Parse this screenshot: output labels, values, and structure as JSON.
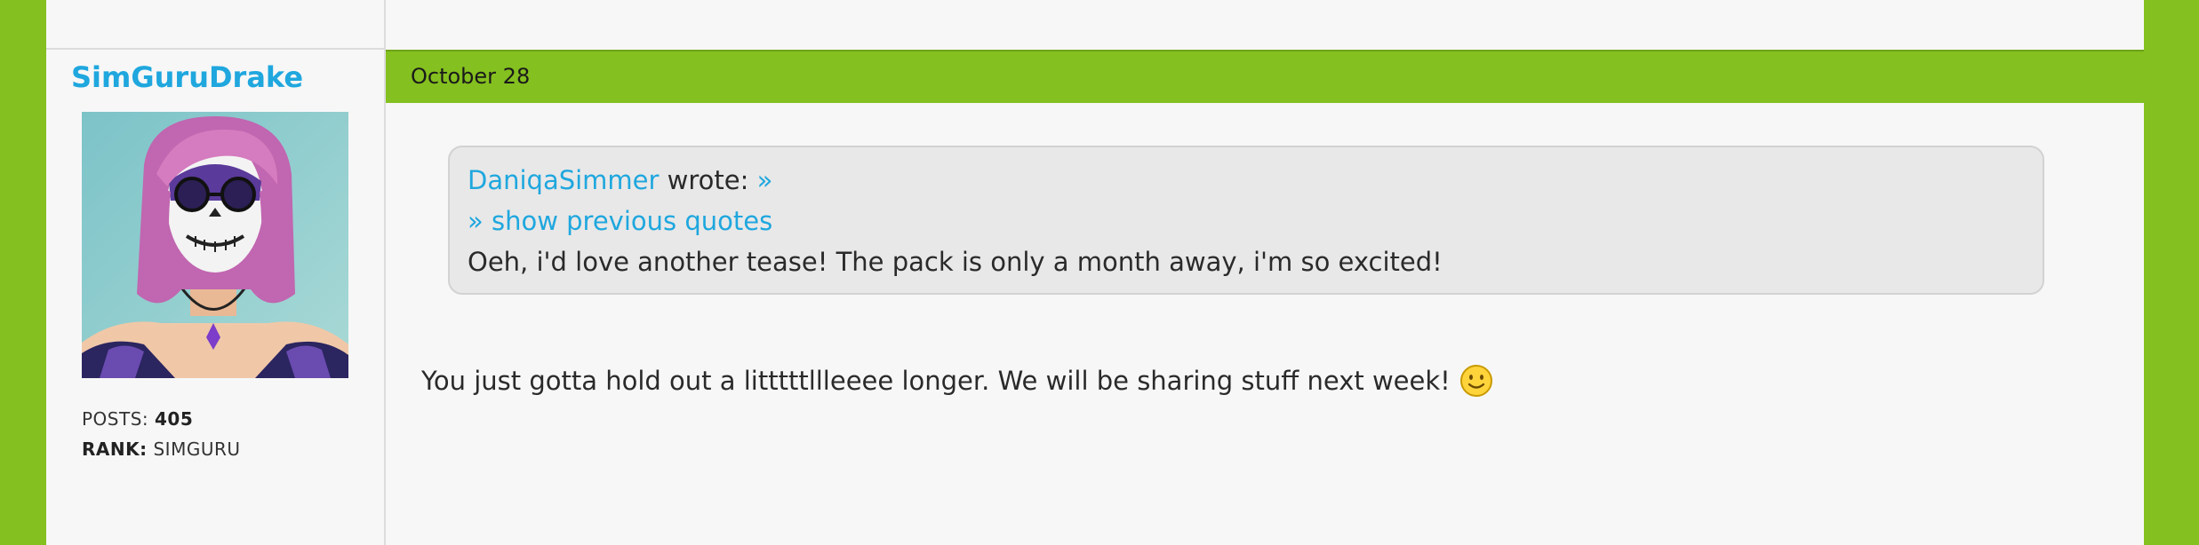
{
  "post": {
    "author": {
      "name": "SimGuruDrake",
      "posts_label": "POSTS:",
      "posts_value": "405",
      "rank_label": "RANK:",
      "rank_value": "SIMGURU"
    },
    "date": "October 28",
    "quote": {
      "author": "DaniqaSimmer",
      "wrote": " wrote: ",
      "jump_link": "»",
      "show_previous": "» show previous quotes",
      "text": "Oeh, i'd love another tease! The pack is only a month away, i'm so excited!"
    },
    "body": "You just gotta hold out a litttttllleeee longer. We will be sharing stuff next week!",
    "emoji": "smiley-icon"
  },
  "colors": {
    "page_background": "#84c01f",
    "header_bar": "#84c01f",
    "link": "#1fa7de",
    "quote_background": "#e8e8e8",
    "content_background": "#f7f7f7"
  }
}
